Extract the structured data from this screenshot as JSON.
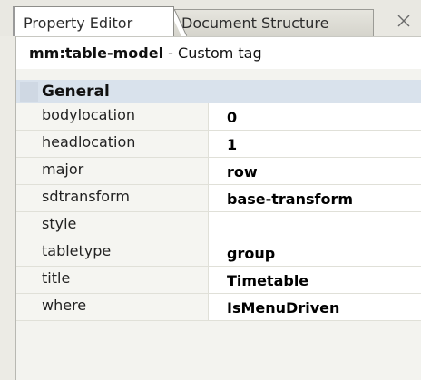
{
  "tabs": [
    {
      "label": "Property Editor",
      "active": true
    },
    {
      "label": "Document Structure",
      "active": false
    }
  ],
  "close_icon": "close-icon",
  "header": {
    "tag_name": "mm:table-model",
    "tag_suffix": " - Custom tag"
  },
  "section": {
    "label": "General",
    "icon": "collapse-handle"
  },
  "properties": [
    {
      "name": "bodylocation",
      "value": "0"
    },
    {
      "name": "headlocation",
      "value": "1"
    },
    {
      "name": "major",
      "value": "row"
    },
    {
      "name": "sdtransform",
      "value": "base-transform"
    },
    {
      "name": "style",
      "value": ""
    },
    {
      "name": "tabletype",
      "value": "group"
    },
    {
      "name": "title",
      "value": "Timetable"
    },
    {
      "name": "where",
      "value": "IsMenuDriven"
    }
  ],
  "colors": {
    "section_header": "#d9e2ec",
    "name_cell": "#f5f5f1",
    "value_cell": "#ffffff",
    "panel_bg": "#f3f3ef"
  }
}
